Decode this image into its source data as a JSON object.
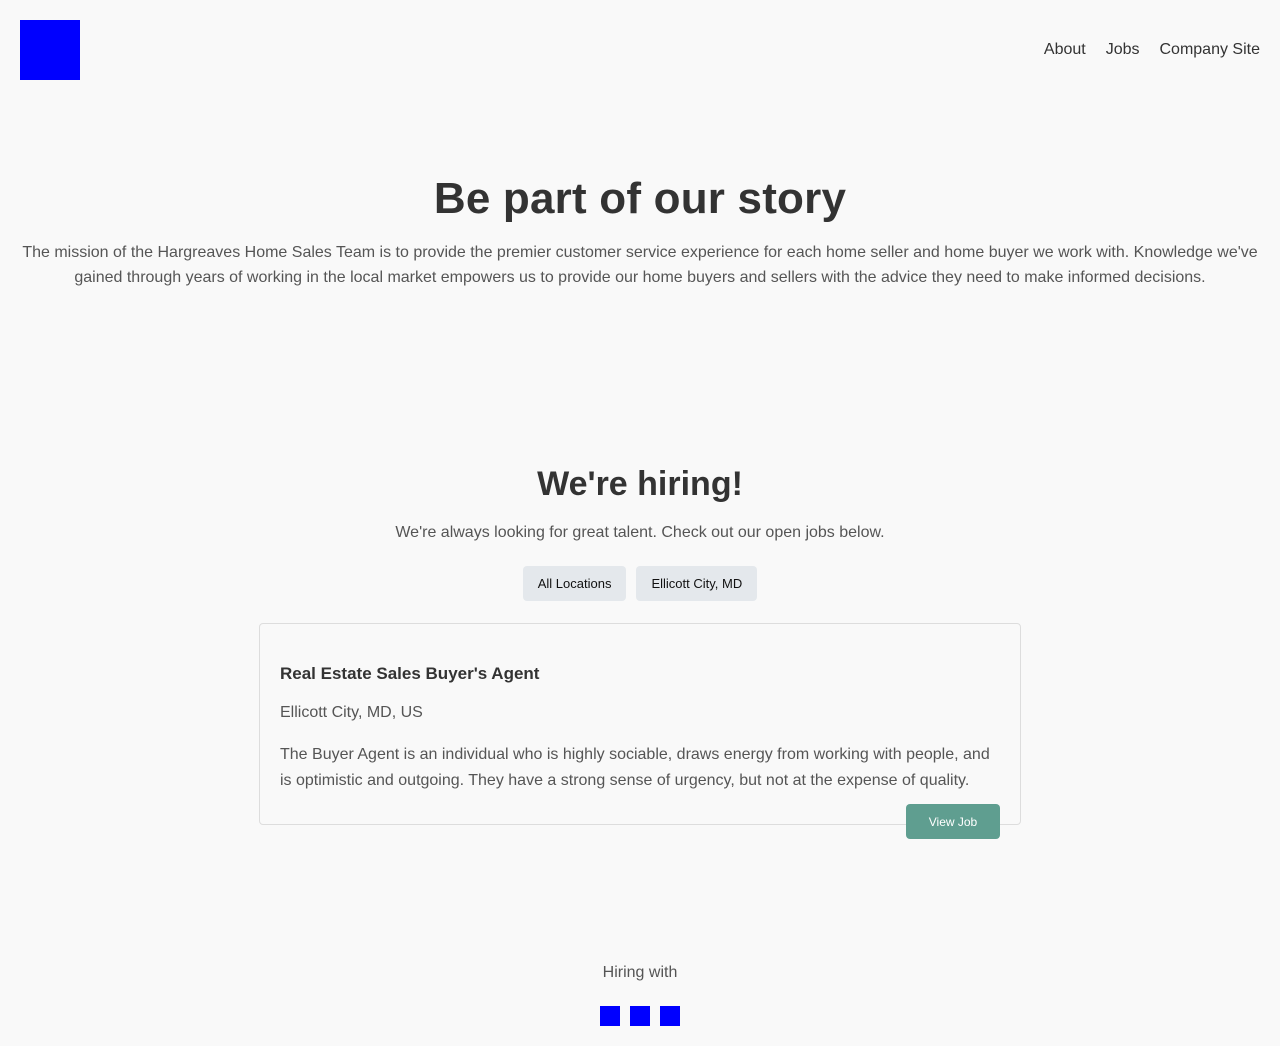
{
  "header": {
    "nav": [
      {
        "label": "About"
      },
      {
        "label": "Jobs"
      },
      {
        "label": "Company Site"
      }
    ]
  },
  "hero": {
    "title": "Be part of our story",
    "description": "The mission of the Hargreaves Home Sales Team is to provide the premier customer service experience for each home seller and home buyer we work with. Knowledge we've gained through years of working in the local market empowers us to provide our home buyers and sellers with the advice they need to make informed decisions."
  },
  "hiring": {
    "title": "We're hiring!",
    "subtitle": "We're always looking for great talent. Check out our open jobs below.",
    "filters": [
      {
        "label": "All Locations"
      },
      {
        "label": "Ellicott City, MD"
      }
    ],
    "jobs": [
      {
        "title": "Real Estate Sales Buyer's Agent",
        "location": "Ellicott City, MD, US",
        "description": "The Buyer Agent is an individual who is highly sociable, draws energy from working with people, and is optimistic and outgoing. They have a strong sense of urgency, but not at the expense of quality.",
        "button_label": "View Job"
      }
    ]
  },
  "footer": {
    "label": "Hiring with",
    "social_icons": [
      "social-icon",
      "social-icon",
      "social-icon"
    ]
  },
  "colors": {
    "logo": "#0000ff",
    "accent_button": "#5f9e90",
    "filter_button": "#e4e8ec",
    "background": "#f9f9f9"
  }
}
